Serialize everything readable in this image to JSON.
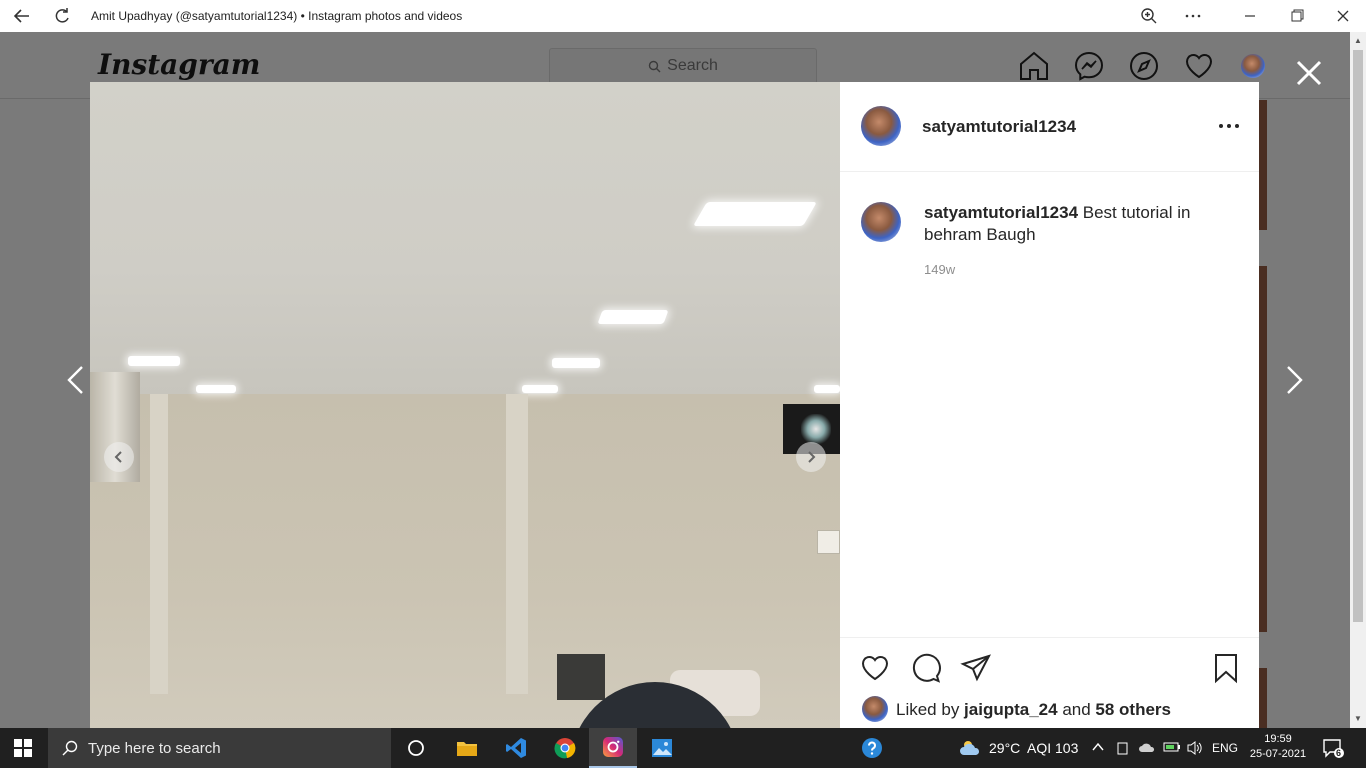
{
  "window": {
    "title": "Amit Upadhyay (@satyamtutorial1234) • Instagram photos and videos"
  },
  "instagram": {
    "logo": "Instagram",
    "search_placeholder": "Search"
  },
  "post": {
    "owner": "satyamtutorial1234",
    "caption_user": "satyamtutorial1234",
    "caption_text": " Best tutorial in behram Baugh",
    "age": "149w",
    "liked_by_prefix": "Liked by ",
    "liked_by_user": "jaigupta_24",
    "liked_by_mid": " and ",
    "liked_by_others": "58 others"
  },
  "taskbar": {
    "search_placeholder": "Type here to search",
    "weather": "29°C",
    "aqi": "AQI 103",
    "language": "ENG",
    "time": "19:59",
    "date": "25-07-2021",
    "notification_count": "6"
  },
  "colors": {
    "accent": "#0078d4",
    "taskbar": "#202020",
    "overlay": "#7a7a7a"
  }
}
